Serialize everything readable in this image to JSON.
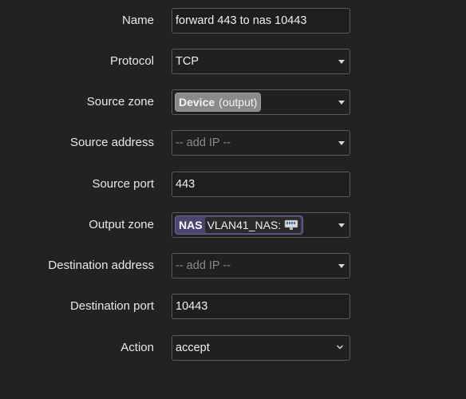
{
  "form": {
    "name": {
      "label": "Name",
      "value": "forward 443 to nas 10443"
    },
    "protocol": {
      "label": "Protocol",
      "value": "TCP"
    },
    "source_zone": {
      "label": "Source zone",
      "zone": "Device",
      "detail": "(output)"
    },
    "source_address": {
      "label": "Source address",
      "placeholder": "-- add IP --"
    },
    "source_port": {
      "label": "Source port",
      "value": "443"
    },
    "output_zone": {
      "label": "Output zone",
      "zone": "NAS",
      "network": "VLAN41_NAS:",
      "icon": "ethernet-port-icon"
    },
    "destination_address": {
      "label": "Destination address",
      "placeholder": "-- add IP --"
    },
    "destination_port": {
      "label": "Destination port",
      "value": "10443"
    },
    "action": {
      "label": "Action",
      "value": "accept"
    }
  },
  "colors": {
    "background": "#222222",
    "field_border": "#5a5a5a",
    "device_zone": "#8a8a8a",
    "nas_zone": "#4d4470"
  }
}
